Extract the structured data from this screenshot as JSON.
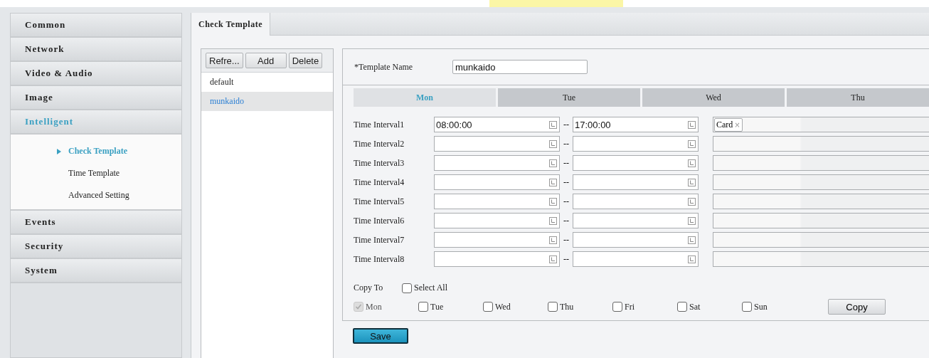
{
  "sidebar": {
    "items": [
      {
        "label": "Common",
        "selected": false
      },
      {
        "label": "Network",
        "selected": false
      },
      {
        "label": "Video & Audio",
        "selected": false
      },
      {
        "label": "Image",
        "selected": false
      },
      {
        "label": "Intelligent",
        "selected": true,
        "expanded": true,
        "children": [
          {
            "label": "Check Template",
            "selected": true
          },
          {
            "label": "Time Template",
            "selected": false
          },
          {
            "label": "Advanced Setting",
            "selected": false
          }
        ]
      },
      {
        "label": "Events",
        "selected": false
      },
      {
        "label": "Security",
        "selected": false
      },
      {
        "label": "System",
        "selected": false
      }
    ]
  },
  "tabs": [
    {
      "label": "Check Template",
      "selected": true
    }
  ],
  "template_list": {
    "buttons": [
      "Refre...",
      "Add",
      "Delete"
    ],
    "items": [
      {
        "label": "default",
        "selected": false
      },
      {
        "label": "munkaido",
        "selected": true
      }
    ]
  },
  "form": {
    "template_name_label": "*Template Name",
    "template_name": "munkaido",
    "days": [
      {
        "label": "Mon",
        "selected": true
      },
      {
        "label": "Tue",
        "selected": false
      },
      {
        "label": "Wed",
        "selected": false
      },
      {
        "label": "Thu",
        "selected": false
      }
    ],
    "intervals": [
      {
        "label": "Time Interval1",
        "start": "08:00:00",
        "separator": "--",
        "end": "17:00:00",
        "tags": [
          "Card"
        ]
      },
      {
        "label": "Time Interval2",
        "separator": "--"
      },
      {
        "label": "Time Interval3",
        "separator": "--"
      },
      {
        "label": "Time Interval4",
        "separator": "--"
      },
      {
        "label": "Time Interval5",
        "separator": "--"
      },
      {
        "label": "Time Interval6",
        "separator": "--"
      },
      {
        "label": "Time Interval7",
        "separator": "--"
      },
      {
        "label": "Time Interval8",
        "separator": "--"
      }
    ],
    "tag_remove": "×",
    "copy_to_label": "Copy To",
    "select_all": {
      "label": "Select All",
      "checked": false
    },
    "copy_days": [
      {
        "label": "Mon",
        "checked": true,
        "disabled": true
      },
      {
        "label": "Tue",
        "checked": false,
        "disabled": false
      },
      {
        "label": "Wed",
        "checked": false,
        "disabled": false
      },
      {
        "label": "Thu",
        "checked": false,
        "disabled": false
      },
      {
        "label": "Fri",
        "checked": false,
        "disabled": false
      },
      {
        "label": "Sat",
        "checked": false,
        "disabled": false
      },
      {
        "label": "Sun",
        "checked": false,
        "disabled": false
      }
    ],
    "copy_button": "Copy",
    "save_button": "Save"
  }
}
